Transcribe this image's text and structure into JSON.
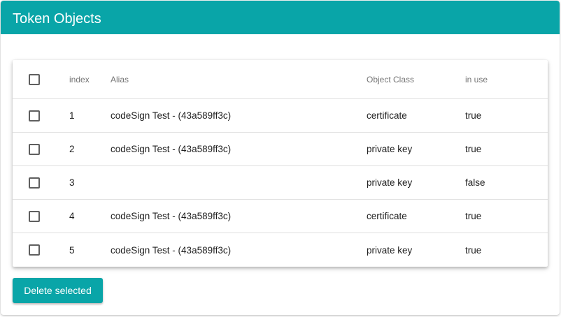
{
  "header": {
    "title": "Token Objects"
  },
  "table": {
    "columns": {
      "index": "index",
      "alias": "Alias",
      "object_class": "Object Class",
      "in_use": "in use"
    },
    "rows": [
      {
        "index": "1",
        "alias": "codeSign Test - (43a589ff3c)",
        "object_class": "certificate",
        "in_use": "true"
      },
      {
        "index": "2",
        "alias": "codeSign Test - (43a589ff3c)",
        "object_class": "private key",
        "in_use": "true"
      },
      {
        "index": "3",
        "alias": "",
        "object_class": "private key",
        "in_use": "false"
      },
      {
        "index": "4",
        "alias": "codeSign Test - (43a589ff3c)",
        "object_class": "certificate",
        "in_use": "true"
      },
      {
        "index": "5",
        "alias": "codeSign Test - (43a589ff3c)",
        "object_class": "private key",
        "in_use": "true"
      }
    ]
  },
  "actions": {
    "delete_label": "Delete selected"
  },
  "colors": {
    "accent": "#09a5a8"
  }
}
